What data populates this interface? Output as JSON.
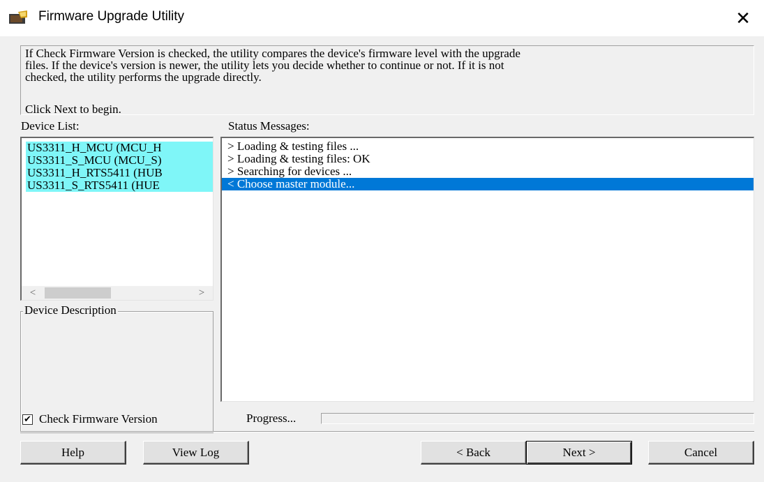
{
  "window": {
    "title": "Firmware Upgrade Utility",
    "close_glyph": "✕"
  },
  "info": {
    "lines": [
      "If Check Firmware Version is checked, the utility compares the device's firmware level with the upgrade",
      "files. If the device's version is newer, the utility lets you decide whether to continue or not. If it is not",
      "checked, the utility performs the upgrade directly."
    ],
    "begin": "Click Next to begin."
  },
  "device_list": {
    "label": "Device List:",
    "items": [
      "US3311_H_MCU (MCU_H",
      "US3311_S_MCU (MCU_S)",
      "US3311_H_RTS5411 (HUB",
      "US3311_S_RTS5411 (HUE"
    ],
    "scroll_left": "<",
    "scroll_right": ">"
  },
  "device_description": {
    "label": "Device Description"
  },
  "status": {
    "label": "Status Messages:",
    "messages": [
      "> Loading & testing files ...",
      "> Loading & testing files: OK",
      "> Searching for devices ...",
      "< Choose master module..."
    ],
    "selected_index": 3
  },
  "check_firmware": {
    "label": "Check Firmware Version",
    "checked": true,
    "check_glyph": "✔"
  },
  "progress": {
    "label": "Progress...",
    "value": 0.0
  },
  "buttons": {
    "help": "Help",
    "view_log": "View Log",
    "back": "< Back",
    "next": "Next >",
    "cancel": "Cancel"
  },
  "colors": {
    "device_highlight": "#7ff6f8",
    "selection": "#0078d7",
    "dialog_bg": "#f0f0f0"
  }
}
